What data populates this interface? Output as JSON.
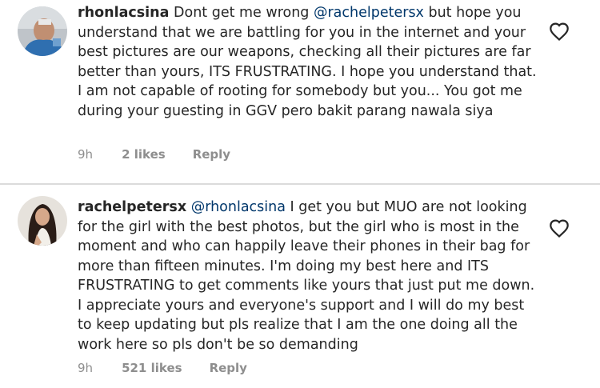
{
  "comments": [
    {
      "username": "rhonlacsina",
      "mention": "",
      "text": "Dont get me wrong ",
      "mention_inline": "@rachelpetersx",
      "text_after": " but hope you understand that we are battling for you in the internet and your best pictures are our weapons, checking all their pictures are far better than yours, ITS FRUSTRATING. I hope you understand that. I am not capable of rooting for somebody but you... You got me during your guesting in GGV pero bakit parang nawala siya",
      "time": "9h",
      "likes": "2 likes",
      "reply": "Reply",
      "avatar_icon": "profile-avatar"
    },
    {
      "username": "rachelpetersx",
      "mention": "@rhonlacsina",
      "text": " I get you but MUO are not looking for the girl with the best photos, but the girl who is most in the moment and who can happily leave their phones in their bag for more than fifteen minutes. I'm doing my best here and ITS FRUSTRATING to get comments like yours that just put me down. I appreciate yours and everyone's support and I will do my best to keep updating but pls realize that I am the one doing all the work here so pls don't be so demanding",
      "time": "9h",
      "likes": "521 likes",
      "reply": "Reply",
      "avatar_icon": "profile-avatar"
    }
  ],
  "colors": {
    "mention": "#00376b",
    "text": "#262626",
    "meta": "#8e8e8e",
    "divider": "#dbdbdb"
  },
  "icons": {
    "like": "heart-icon"
  }
}
